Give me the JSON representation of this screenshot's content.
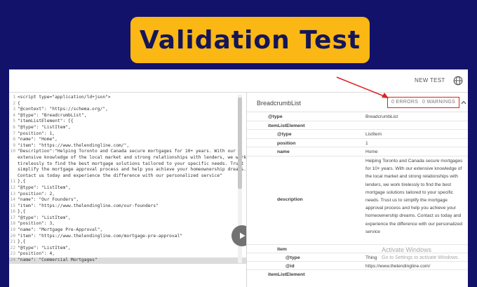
{
  "banner": {
    "title": "Validation Test"
  },
  "toolbar": {
    "new_test_label": "NEW TEST",
    "globe_icon": "globe-icon"
  },
  "code": {
    "lines": [
      {
        "n": "1",
        "t": "<script type=\"application/ld+json\">"
      },
      {
        "n": "2",
        "t": "{"
      },
      {
        "n": "3",
        "t": "\"@context\": \"https://schema.org/\","
      },
      {
        "n": "4",
        "t": "\"@type\": \"BreadcrumbList\","
      },
      {
        "n": "5",
        "t": "\"itemListElement\": [{"
      },
      {
        "n": "6",
        "t": "\"@type\": \"ListItem\","
      },
      {
        "n": "7",
        "t": "\"position\": 1,"
      },
      {
        "n": "8",
        "t": "\"name\": \"Home\","
      },
      {
        "n": "9",
        "t": "\"item\": \"https://www.thelendingline.com/\","
      },
      {
        "n": "10",
        "t": "\"Description\":\"Helping Toronto and Canada secure mortgages for 10+ years. With our"
      },
      {
        "n": "",
        "t": "extensive knowledge of the local market and strong relationships with lenders, we work"
      },
      {
        "n": "",
        "t": "tirelessly to find the best mortgage solutions tailored to your specific needs. Trust us"
      },
      {
        "n": "",
        "t": "simplify the mortgage approval process and help you achieve your homeownership dreams."
      },
      {
        "n": "",
        "t": "Contact us today and experience the difference with our personalized service\""
      },
      {
        "n": "11",
        "t": "},{"
      },
      {
        "n": "12",
        "t": "\"@type\": \"ListItem\","
      },
      {
        "n": "13",
        "t": "\"position\": 2,"
      },
      {
        "n": "14",
        "t": "\"name\": \"Our Founders\","
      },
      {
        "n": "15",
        "t": "\"item\": \"https://www.thelendingline.com/our-founders\""
      },
      {
        "n": "16",
        "t": "},{"
      },
      {
        "n": "17",
        "t": "\"@type\": \"ListItem\","
      },
      {
        "n": "18",
        "t": "\"position\": 3,"
      },
      {
        "n": "19",
        "t": "\"name\": \"Mortgage Pre-Approval\","
      },
      {
        "n": "20",
        "t": "\"item\": \"https://www.thelendingline.com/mortgage-pre-approval\""
      },
      {
        "n": "21",
        "t": "},{"
      },
      {
        "n": "22",
        "t": "\"@type\": \"ListItem\","
      },
      {
        "n": "23",
        "t": "\"position\": 4,"
      },
      {
        "n": "24",
        "t": "\"name\": \"Commercial Mortgages\""
      }
    ]
  },
  "results": {
    "title": "BreadcrumbList",
    "errors_label": "0 ERRORS",
    "warnings_label": "0 WARNINGS",
    "rows": {
      "type_key": "@type",
      "type_val": "BreadcrumbList",
      "list_key": "itemListElement",
      "item_type_key": "@type",
      "item_type_val": "ListItem",
      "position_key": "position",
      "position_val": "1",
      "name_key": "name",
      "name_val": "Home",
      "desc_key": "description",
      "desc_val": "Helping Toronto and Canada secure mortgages for 10+ years. With our extensive knowledge of the local market and strong relationships with lenders, we work tirelessly to find the best mortgage solutions tailored to your specific needs. Trust us to simplify the mortgage approval process and help you achieve your homeownership dreams. Contact us today and experience the difference with our personalized service",
      "item_key": "item",
      "thing_type_key": "@type",
      "thing_type_val": "Thing",
      "id_key": "@id",
      "id_val": "https://www.thelendingline.com/",
      "next_key": "itemListElement"
    }
  },
  "watermark": {
    "line1": "Activate Windows",
    "line2": "Go to Settings to activate Windows."
  },
  "colors": {
    "background": "#12126b",
    "banner": "#fbb714",
    "highlight_box": "#e02020"
  }
}
